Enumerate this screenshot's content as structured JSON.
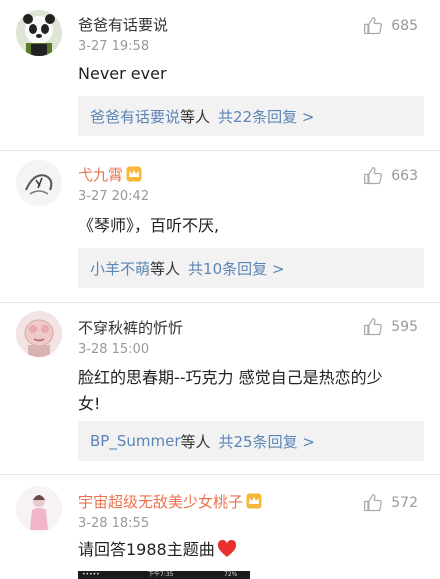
{
  "comments": [
    {
      "username": "爸爸有话要说",
      "time": "3-27 19:58",
      "likes": "685",
      "text": "Never ever",
      "reply": {
        "names": "爸爸有话要说",
        "mid": "等人",
        "count": "共22条回复 >"
      }
    },
    {
      "username": "弋九霄",
      "time": "3-27 20:42",
      "likes": "663",
      "text": "《琴师》，百听不厌,",
      "reply": {
        "names": "小羊不萌",
        "mid": "等人",
        "count": "共10条回复 >"
      }
    },
    {
      "username": "不穿秋裤的忻忻",
      "time": "3-28 15:00",
      "likes": "595",
      "text_line1": "脸红的思春期--巧克力  感觉自己是热恋的少",
      "text_line2": "女!",
      "reply": {
        "names": "BP_Summer",
        "mid": "等人",
        "count": "共25条回复 >"
      }
    },
    {
      "username": "宇宙超级无敌美少女桃子",
      "time": "3-28 18:55",
      "likes": "572",
      "text": "请回答1988主题曲"
    }
  ],
  "statusbar": {
    "left": "•••••",
    "time": "下午7:35",
    "battery": "72%"
  },
  "colors": {
    "orange_name": "#eb7350",
    "link_blue": "#5b85b5",
    "meta_gray": "#999999",
    "reply_bg": "#f2f2f2",
    "heart_red": "#e8312f"
  },
  "icons": {
    "like": "thumbs-up-icon",
    "vip": "crown-icon",
    "heart": "heart-icon"
  }
}
